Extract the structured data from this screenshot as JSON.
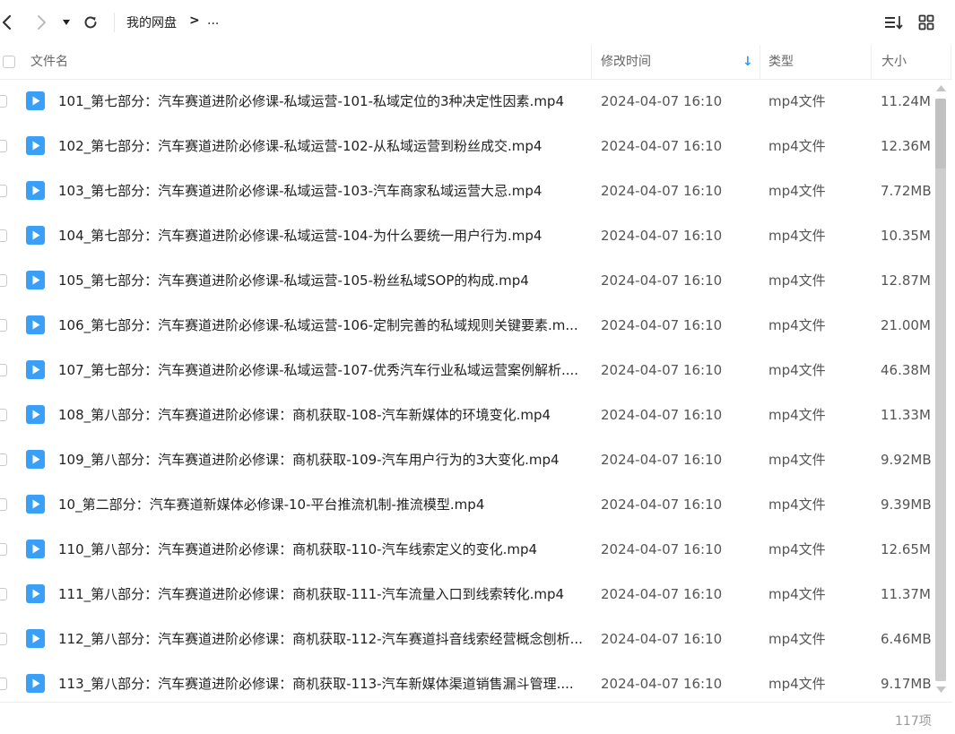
{
  "toolbar": {
    "breadcrumb_root": "我的网盘",
    "breadcrumb_sep": ">",
    "breadcrumb_more": "...",
    "icons": [
      "back-icon",
      "forward-icon",
      "dropdown-icon",
      "refresh-icon",
      "sort-list-icon",
      "grid-view-icon"
    ]
  },
  "table": {
    "headers": {
      "name": "文件名",
      "modified": "修改时间",
      "type": "类型",
      "size": "大小"
    },
    "sort_indicator": "↓",
    "rows": [
      {
        "name": "101_第七部分：汽车赛道进阶必修课-私域运营-101-私域定位的3种决定性因素.mp4",
        "modified": "2024-04-07 16:10",
        "type": "mp4文件",
        "size": "11.24M"
      },
      {
        "name": "102_第七部分：汽车赛道进阶必修课-私域运营-102-从私域运营到粉丝成交.mp4",
        "modified": "2024-04-07 16:10",
        "type": "mp4文件",
        "size": "12.36M"
      },
      {
        "name": "103_第七部分：汽车赛道进阶必修课-私域运营-103-汽车商家私域运营大忌.mp4",
        "modified": "2024-04-07 16:10",
        "type": "mp4文件",
        "size": "7.72MB"
      },
      {
        "name": "104_第七部分：汽车赛道进阶必修课-私域运营-104-为什么要统一用户行为.mp4",
        "modified": "2024-04-07 16:10",
        "type": "mp4文件",
        "size": "10.35M"
      },
      {
        "name": "105_第七部分：汽车赛道进阶必修课-私域运营-105-粉丝私域SOP的构成.mp4",
        "modified": "2024-04-07 16:10",
        "type": "mp4文件",
        "size": "12.87M"
      },
      {
        "name": "106_第七部分：汽车赛道进阶必修课-私域运营-106-定制完善的私域规则关键要素.m...",
        "modified": "2024-04-07 16:10",
        "type": "mp4文件",
        "size": "21.00M"
      },
      {
        "name": "107_第七部分：汽车赛道进阶必修课-私域运营-107-优秀汽车行业私域运营案例解析....",
        "modified": "2024-04-07 16:10",
        "type": "mp4文件",
        "size": "46.38M"
      },
      {
        "name": "108_第八部分：汽车赛道进阶必修课：商机获取-108-汽车新媒体的环境变化.mp4",
        "modified": "2024-04-07 16:10",
        "type": "mp4文件",
        "size": "11.33M"
      },
      {
        "name": "109_第八部分：汽车赛道进阶必修课：商机获取-109-汽车用户行为的3大变化.mp4",
        "modified": "2024-04-07 16:10",
        "type": "mp4文件",
        "size": "9.92MB"
      },
      {
        "name": "10_第二部分：汽车赛道新媒体必修课-10-平台推流机制-推流模型.mp4",
        "modified": "2024-04-07 16:10",
        "type": "mp4文件",
        "size": "9.39MB"
      },
      {
        "name": "110_第八部分：汽车赛道进阶必修课：商机获取-110-汽车线索定义的变化.mp4",
        "modified": "2024-04-07 16:10",
        "type": "mp4文件",
        "size": "12.65M"
      },
      {
        "name": "111_第八部分：汽车赛道进阶必修课：商机获取-111-汽车流量入口到线索转化.mp4",
        "modified": "2024-04-07 16:10",
        "type": "mp4文件",
        "size": "11.37M"
      },
      {
        "name": "112_第八部分：汽车赛道进阶必修课：商机获取-112-汽车赛道抖音线索经营概念刨析...",
        "modified": "2024-04-07 16:10",
        "type": "mp4文件",
        "size": "6.46MB"
      },
      {
        "name": "113_第八部分：汽车赛道进阶必修课：商机获取-113-汽车新媒体渠道销售漏斗管理....",
        "modified": "2024-04-07 16:10",
        "type": "mp4文件",
        "size": "9.17MB"
      }
    ]
  },
  "footer": {
    "count": "117项"
  },
  "colors": {
    "accent": "#2f9bf5",
    "icon": "#3aa0f7"
  }
}
